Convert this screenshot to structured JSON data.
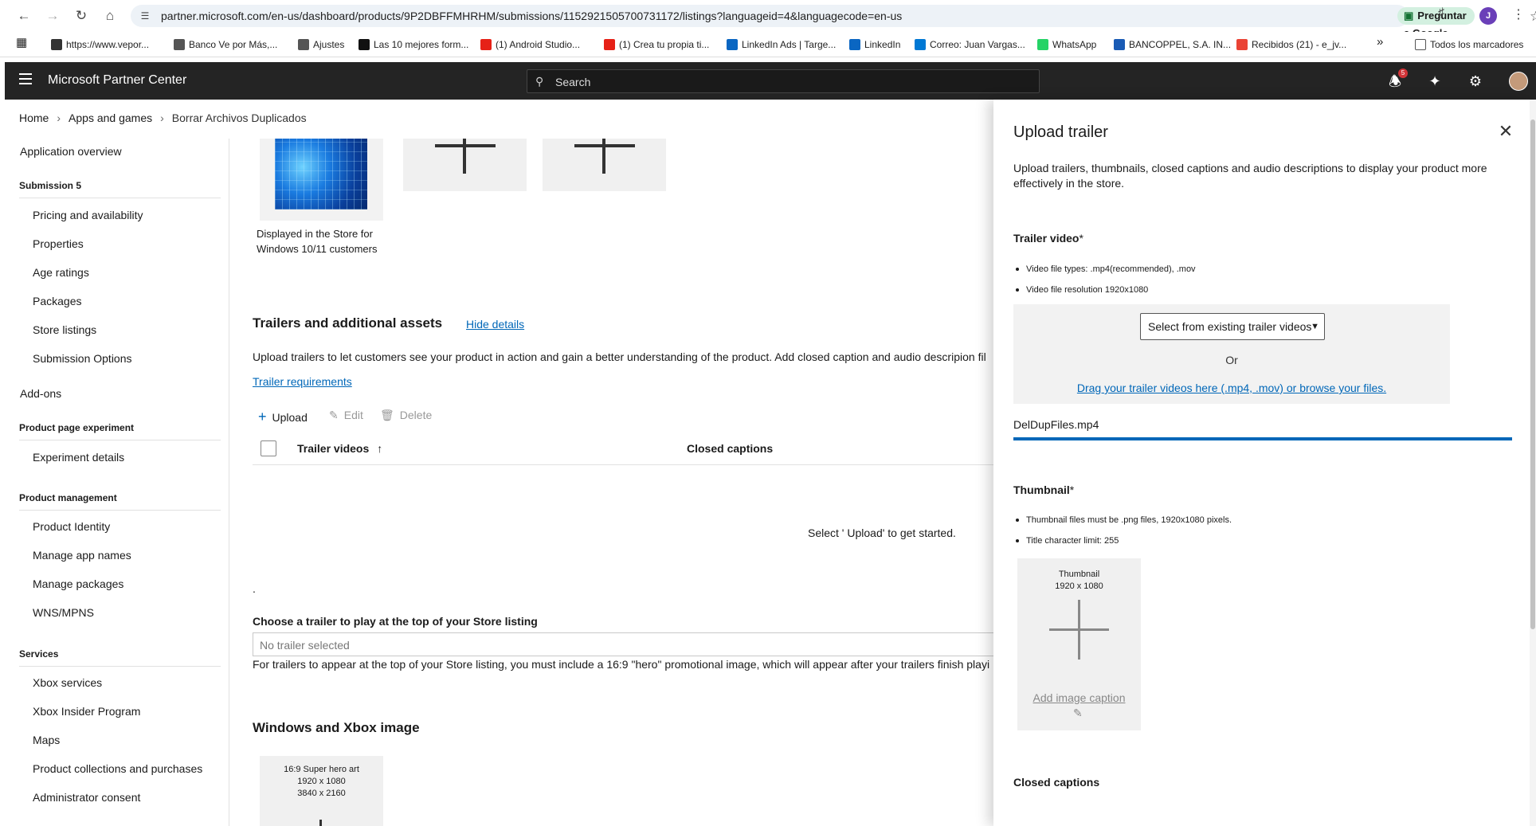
{
  "browser": {
    "url": "partner.microsoft.com/en-us/dashboard/products/9P2DBFFMHRHM/submissions/1152921505700731172/listings?languageid=4&languagecode=en-us",
    "google_button": "Preguntar a Google",
    "profile_initial": "J",
    "bookmarks": [
      {
        "label": "https://www.vepor...",
        "color": "#333333"
      },
      {
        "label": "Banco Ve por Más,...",
        "color": "#555555"
      },
      {
        "label": "Ajustes",
        "color": "#555555"
      },
      {
        "label": "Las 10 mejores form...",
        "color": "#111111"
      },
      {
        "label": "(1) Android Studio...",
        "color": "#e62117"
      },
      {
        "label": "(1) Crea tu propia ti...",
        "color": "#e62117"
      },
      {
        "label": "LinkedIn Ads | Targe...",
        "color": "#0a66c2"
      },
      {
        "label": "LinkedIn",
        "color": "#0a66c2"
      },
      {
        "label": "Correo: Juan Vargas...",
        "color": "#0078d4"
      },
      {
        "label": "WhatsApp",
        "color": "#25d366"
      },
      {
        "label": "BANCOPPEL, S.A. IN...",
        "color": "#1a5bb5"
      },
      {
        "label": "Recibidos (21) - e_jv...",
        "color": "#ea4335"
      }
    ],
    "more_bookmarks": "»",
    "all_bookmarks": "Todos los marcadores"
  },
  "header": {
    "title": "Microsoft Partner Center",
    "search_placeholder": "Search",
    "notification_count": "5"
  },
  "breadcrumb": {
    "home": "Home",
    "section": "Apps and games",
    "current": "Borrar Archivos Duplicados"
  },
  "sidebar": {
    "overview": "Application overview",
    "submission_head": "Submission 5",
    "submission_items": [
      "Pricing and availability",
      "Properties",
      "Age ratings",
      "Packages",
      "Store listings",
      "Submission Options"
    ],
    "addons": "Add-ons",
    "experiment_head": "Product page experiment",
    "experiment_items": [
      "Experiment details"
    ],
    "management_head": "Product management",
    "management_items": [
      "Product Identity",
      "Manage app names",
      "Manage packages",
      "WNS/MPNS"
    ],
    "services_head": "Services",
    "services_items": [
      "Xbox services",
      "Xbox Insider Program",
      "Maps",
      "Product collections and purchases",
      "Administrator consent"
    ]
  },
  "main": {
    "image_caption": "Displayed in the Store for Windows 10/11 customers",
    "trailers_title": "Trailers and additional assets",
    "hide_details": "Hide details",
    "trailers_desc": "Upload trailers to let customers see your product in action and gain a better understanding of the product. Add closed caption and audio descripion fil",
    "trailer_requirements": "Trailer requirements",
    "cmd_upload": "Upload",
    "cmd_edit": "Edit",
    "cmd_delete": "Delete",
    "col_trailer_videos": "Trailer videos",
    "col_closed_captions": "Closed captions",
    "empty_message": "Select ' Upload' to get started.",
    "dot": ".",
    "choose_label": "Choose a trailer to play at the top of your Store listing",
    "choose_placeholder": "No trailer selected",
    "choose_note": "For trailers to appear at the top of your Store listing, you must include a 16:9 \"hero\" promotional image, which will appear after your trailers finish playi",
    "windows_xbox_title": "Windows and Xbox image",
    "hero_tile": {
      "line1": "16:9 Super hero art",
      "line2": "1920 x 1080",
      "line3": "3840 x 2160"
    }
  },
  "panel": {
    "title": "Upload trailer",
    "description": "Upload trailers, thumbnails, closed captions and audio descriptions to display your product more effectively in the store.",
    "trailer_video_label": "Trailer video",
    "required_mark": "*",
    "trailer_bullets": [
      "Video file types: .mp4(recommended), .mov",
      "Video file resolution 1920x1080"
    ],
    "existing_select": "Select from existing trailer videos",
    "or": "Or",
    "drag_link": "Drag your trailer videos here (.mp4, .mov) or browse your files.",
    "file_name": "DelDupFiles.mp4",
    "upload_progress": 1.0,
    "thumbnail_label": "Thumbnail",
    "thumbnail_bullets": [
      "Thumbnail files must be .png files, 1920x1080 pixels.",
      "Title character limit: 255"
    ],
    "thumb_tile_line1": "Thumbnail",
    "thumb_tile_line2": "1920 x 1080",
    "add_caption": "Add image caption",
    "closed_captions_label": "Closed captions"
  }
}
